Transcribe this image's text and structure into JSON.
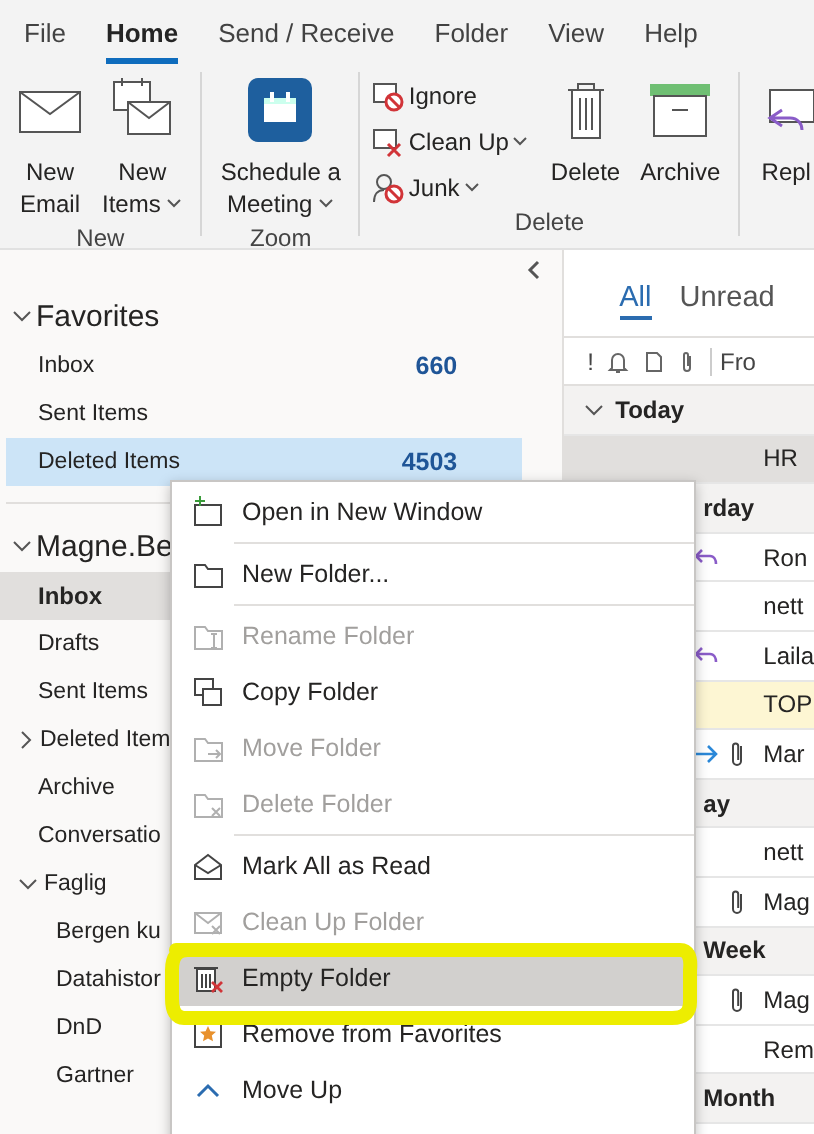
{
  "menu_tabs": [
    {
      "label": "File",
      "selected": false
    },
    {
      "label": "Home",
      "selected": true
    },
    {
      "label": "Send / Receive",
      "selected": false
    },
    {
      "label": "Folder",
      "selected": false
    },
    {
      "label": "View",
      "selected": false
    },
    {
      "label": "Help",
      "selected": false
    }
  ],
  "ribbon": {
    "groups": [
      {
        "label": "New",
        "buttons": [
          {
            "kind": "large",
            "lines": [
              "New",
              "Email"
            ],
            "dropdown": false
          },
          {
            "kind": "large",
            "lines": [
              "New",
              "Items"
            ],
            "dropdown": true
          }
        ]
      },
      {
        "label": "Zoom",
        "buttons": [
          {
            "kind": "large",
            "lines": [
              "Schedule a",
              "Meeting"
            ],
            "dropdown": true
          }
        ]
      },
      {
        "label": "Delete",
        "buttons": [
          {
            "kind": "small",
            "lines": [
              "Ignore"
            ],
            "dropdown": false
          },
          {
            "kind": "small",
            "lines": [
              "Clean Up"
            ],
            "dropdown": true
          },
          {
            "kind": "small",
            "lines": [
              "Junk"
            ],
            "dropdown": true
          },
          {
            "kind": "large",
            "lines": [
              "Delete"
            ],
            "dropdown": false
          },
          {
            "kind": "large",
            "lines": [
              "Archive"
            ],
            "dropdown": false
          }
        ]
      },
      {
        "buttons": [
          {
            "kind": "large",
            "lines": [
              "Repl"
            ],
            "dropdown": false
          }
        ]
      }
    ]
  },
  "folder_pane": {
    "sections": [
      {
        "title": "Favorites",
        "expanded": true,
        "items": [
          {
            "name": "Inbox",
            "count": "660",
            "selected": false
          },
          {
            "name": "Sent Items",
            "selected": false
          },
          {
            "name": "Deleted Items",
            "count": "4503",
            "selected": true
          }
        ]
      },
      {
        "title": "Magne.Be",
        "expanded": true,
        "items": [
          {
            "name": "Inbox",
            "selected": false,
            "bold": true
          },
          {
            "name": "Drafts",
            "selected": false
          },
          {
            "name": "Sent Items",
            "selected": false
          },
          {
            "name": "Deleted Item",
            "selected": false,
            "expanded": false
          },
          {
            "name": "Archive",
            "selected": false
          },
          {
            "name": "Conversatio",
            "selected": false
          },
          {
            "name": "Faglig",
            "selected": false,
            "expanded": true,
            "children": [
              {
                "name": "Bergen ku",
                "selected": false
              },
              {
                "name": "Datahistor",
                "selected": false
              },
              {
                "name": "DnD",
                "selected": false
              },
              {
                "name": "Gartner",
                "selected": false
              }
            ]
          }
        ]
      }
    ]
  },
  "mail_list": {
    "filters": [
      {
        "label": "All",
        "selected": true
      },
      {
        "label": "Unread",
        "selected": false
      }
    ],
    "column_headers": [
      "!",
      "Fro"
    ],
    "rows": [
      {
        "kind": "group",
        "label": "Today",
        "expanded": true
      },
      {
        "kind": "mail",
        "from": "HR",
        "selected": true,
        "attachment": false
      },
      {
        "kind": "group",
        "label": "rday"
      },
      {
        "kind": "mail",
        "from": "Ron",
        "selected": false,
        "replied": true,
        "attachment": false
      },
      {
        "kind": "mail",
        "from": "nett",
        "selected": false,
        "attachment": false
      },
      {
        "kind": "mail",
        "from": "Laila",
        "selected": false,
        "replied": true,
        "attachment": false
      },
      {
        "kind": "mail",
        "from": "TOP",
        "selected": false,
        "pinned": true,
        "attachment": false
      },
      {
        "kind": "mail",
        "from": "Mar",
        "selected": false,
        "forwarded": true,
        "attachment": true
      },
      {
        "kind": "group",
        "label": "ay"
      },
      {
        "kind": "mail",
        "from": "nett",
        "selected": false,
        "attachment": false
      },
      {
        "kind": "mail",
        "from": "Mag",
        "selected": false,
        "attachment": true
      },
      {
        "kind": "group",
        "label": "Week"
      },
      {
        "kind": "mail",
        "from": "Mag",
        "selected": false,
        "attachment": true
      },
      {
        "kind": "mail",
        "from": "Rem",
        "selected": false,
        "attachment": false
      },
      {
        "kind": "group",
        "label": "Month"
      }
    ]
  },
  "context_menu": {
    "sections": [
      [
        {
          "label": "Open in New Window",
          "disabled": false,
          "selected": false
        }
      ],
      [
        {
          "label": "New Folder...",
          "disabled": false,
          "selected": false
        }
      ],
      [
        {
          "label": "Rename Folder",
          "disabled": true,
          "selected": false
        },
        {
          "label": "Copy Folder",
          "disabled": false,
          "selected": false
        },
        {
          "label": "Move Folder",
          "disabled": true,
          "selected": false
        },
        {
          "label": "Delete Folder",
          "disabled": true,
          "selected": false
        }
      ],
      [
        {
          "label": "Mark All as Read",
          "disabled": false,
          "selected": false
        },
        {
          "label": "Clean Up Folder",
          "disabled": true,
          "selected": false
        },
        {
          "label": "Empty Folder",
          "disabled": false,
          "selected": true
        },
        {
          "label": "Remove from Favorites",
          "disabled": false,
          "selected": false
        },
        {
          "label": "Move Up",
          "disabled": false,
          "selected": false
        }
      ]
    ]
  },
  "annotation": {
    "highlight": true
  }
}
